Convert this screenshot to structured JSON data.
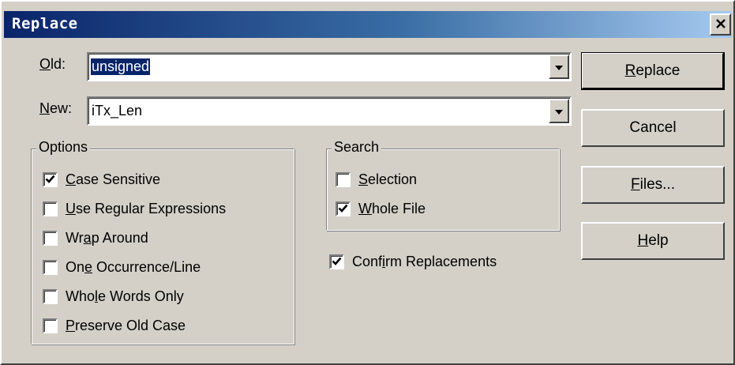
{
  "window": {
    "title": "Replace",
    "close_glyph": "✕"
  },
  "fields": {
    "old": {
      "label_u": "O",
      "label_rest": "ld:",
      "value": "unsigned"
    },
    "new": {
      "label_u": "N",
      "label_rest": "ew:",
      "value": "iTx_Len"
    }
  },
  "options": {
    "title": "Options",
    "items": [
      {
        "pre": "",
        "u": "C",
        "post": "ase Sensitive",
        "checked": true
      },
      {
        "pre": "",
        "u": "U",
        "post": "se Regular Expressions",
        "checked": false
      },
      {
        "pre": "Wr",
        "u": "a",
        "post": "p Around",
        "checked": false
      },
      {
        "pre": "On",
        "u": "e",
        "post": " Occurrence/Line",
        "checked": false
      },
      {
        "pre": "Who",
        "u": "l",
        "post": "e Words Only",
        "checked": false
      },
      {
        "pre": "",
        "u": "P",
        "post": "reserve Old Case",
        "checked": false
      }
    ]
  },
  "search": {
    "title": "Search",
    "items": [
      {
        "pre": "",
        "u": "S",
        "post": "election",
        "checked": false
      },
      {
        "pre": "",
        "u": "W",
        "post": "hole File",
        "checked": true
      }
    ]
  },
  "confirm": {
    "pre": "Conf",
    "u": "i",
    "post": "rm Replacements",
    "checked": true
  },
  "buttons": {
    "replace": {
      "u": "R",
      "rest": "eplace"
    },
    "cancel": {
      "label": "Cancel"
    },
    "files": {
      "u": "F",
      "rest": "iles..."
    },
    "help": {
      "u": "H",
      "rest": "elp"
    }
  },
  "icons": {
    "dropdown_arrow": "dropdown-arrow-icon",
    "checkmark": "checkmark-icon",
    "close": "close-icon"
  },
  "colors": {
    "titlebar_start": "#0a246a",
    "titlebar_end": "#a6caf0",
    "face": "#d4d0c8",
    "selection": "#0a246a"
  }
}
